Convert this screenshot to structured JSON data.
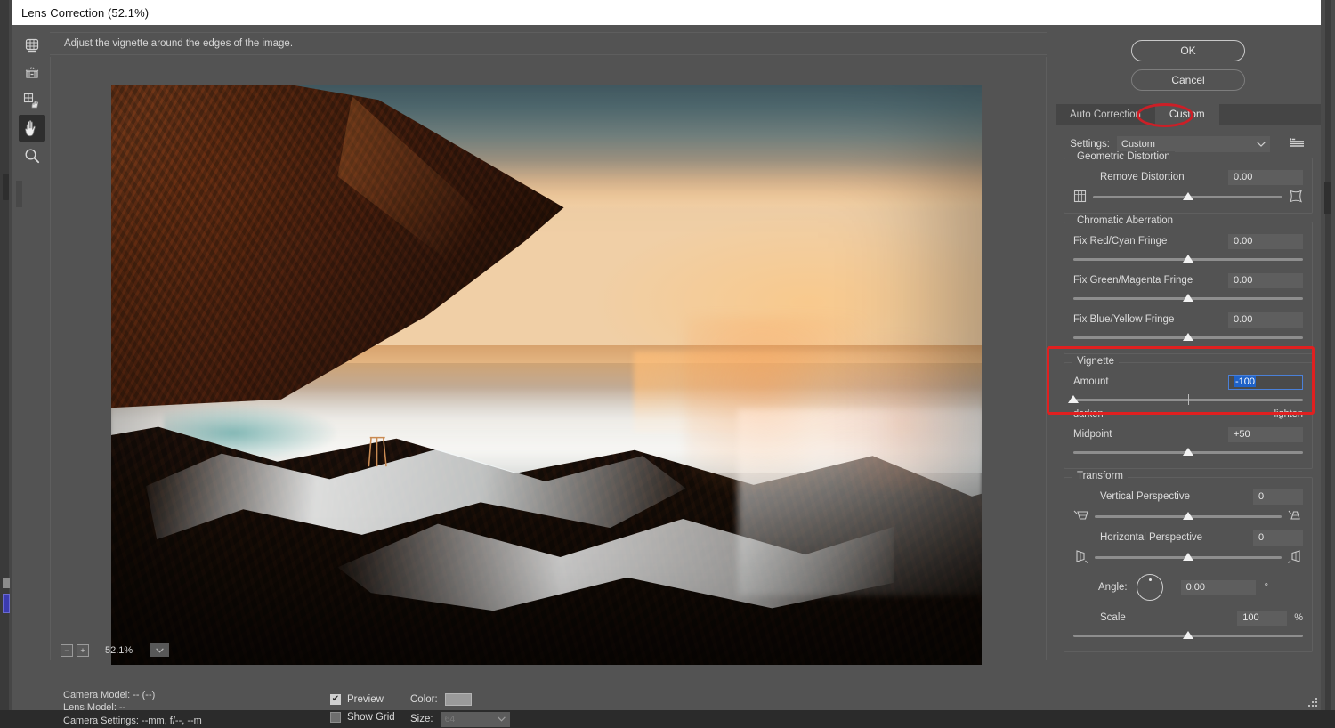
{
  "window": {
    "title": "Lens Correction (52.1%)"
  },
  "hint": {
    "text": "Adjust the vignette around the edges of the image."
  },
  "toolbar": {
    "tools": [
      {
        "name": "remove-distortion-tool",
        "icon": "grid-lens-icon",
        "active": false
      },
      {
        "name": "straighten-tool",
        "icon": "level-icon",
        "active": false
      },
      {
        "name": "move-grid-tool",
        "icon": "move-grid-icon",
        "active": false
      },
      {
        "name": "hand-tool",
        "icon": "hand-icon",
        "active": true
      },
      {
        "name": "zoom-tool",
        "icon": "magnifier-icon",
        "active": false
      }
    ]
  },
  "buttons": {
    "ok": "OK",
    "cancel": "Cancel"
  },
  "tabs": [
    {
      "label": "Auto Correction",
      "active": false
    },
    {
      "label": "Custom",
      "active": true
    }
  ],
  "settings": {
    "label": "Settings:",
    "value": "Custom",
    "menu_icon": "panel-flyout-menu-icon"
  },
  "geometric_distortion": {
    "title": "Geometric Distortion",
    "remove_distortion": {
      "label": "Remove Distortion",
      "value": "0.00",
      "thumb_percent": 50
    },
    "left_icon": "barrel-distortion-icon",
    "right_icon": "pincushion-distortion-icon"
  },
  "chromatic_aberration": {
    "title": "Chromatic Aberration",
    "rows": [
      {
        "label": "Fix Red/Cyan Fringe",
        "value": "0.00",
        "thumb_percent": 50
      },
      {
        "label": "Fix Green/Magenta Fringe",
        "value": "0.00",
        "thumb_percent": 50
      },
      {
        "label": "Fix Blue/Yellow Fringe",
        "value": "0.00",
        "thumb_percent": 50
      }
    ]
  },
  "vignette": {
    "title": "Vignette",
    "amount": {
      "label": "Amount",
      "value": "-100",
      "focused": true,
      "selected": true,
      "thumb_percent": 0,
      "tick_percent": 50,
      "left_label": "darken",
      "right_label": "lighten"
    },
    "midpoint": {
      "label": "Midpoint",
      "value": "+50",
      "thumb_percent": 50
    }
  },
  "transform": {
    "title": "Transform",
    "vertical_perspective": {
      "label": "Vertical Perspective",
      "value": "0",
      "thumb_percent": 50,
      "left_icon": "vertical-perspective-left-icon",
      "right_icon": "vertical-perspective-right-icon"
    },
    "horizontal_perspective": {
      "label": "Horizontal Perspective",
      "value": "0",
      "thumb_percent": 50,
      "left_icon": "horizontal-perspective-left-icon",
      "right_icon": "horizontal-perspective-right-icon"
    },
    "angle": {
      "label": "Angle:",
      "value": "0.00",
      "unit": "°"
    },
    "scale": {
      "label": "Scale",
      "value": "100",
      "unit": "%",
      "thumb_percent": 50
    }
  },
  "zoom_controls": {
    "zoom_out": "−",
    "zoom_in": "+",
    "level": "52.1%",
    "chevron_icon": "chevron-down-icon"
  },
  "status": {
    "camera_model": "Camera Model: -- (--)",
    "lens_model": "Lens Model: --",
    "camera_settings": "Camera Settings: --mm, f/--, --m"
  },
  "options": {
    "preview": {
      "label": "Preview",
      "checked": true
    },
    "show_grid": {
      "label": "Show Grid",
      "checked": false
    },
    "color": {
      "label": "Color:",
      "swatch_hex": "#9a9a9a"
    },
    "size": {
      "label": "Size:",
      "value": "64",
      "disabled": true
    }
  },
  "annotations": {
    "custom_tab_highlight_color": "#cc1f27",
    "vignette_highlight_color": "#e02020"
  }
}
